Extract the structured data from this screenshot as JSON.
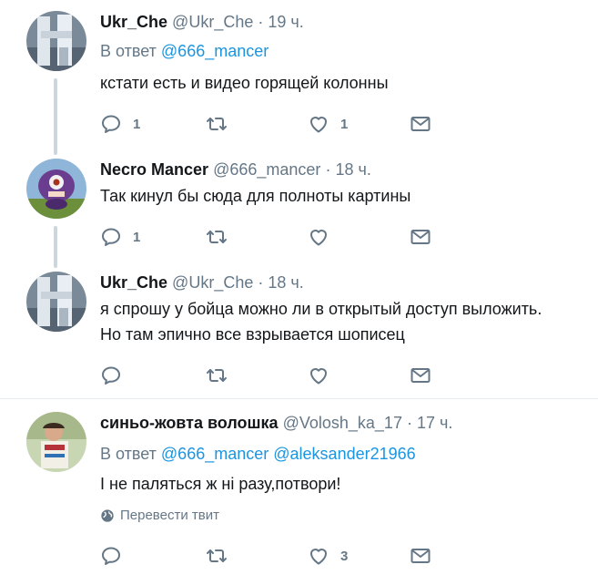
{
  "tweets": [
    {
      "name": "Ukr_Che",
      "handle": "@Ukr_Che",
      "dot": "·",
      "time": "19 ч.",
      "reply_prefix": "В ответ",
      "reply_mentions": [
        "@666_mancer"
      ],
      "text": "кстати есть и видео горящей колонны",
      "replies": "1",
      "retweets": "",
      "likes": "1"
    },
    {
      "name": "Necro Mancer",
      "handle": "@666_mancer",
      "dot": "·",
      "time": "18 ч.",
      "text": "Так кинул бы сюда для полноты картины",
      "replies": "1",
      "retweets": "",
      "likes": ""
    },
    {
      "name": "Ukr_Che",
      "handle": "@Ukr_Che",
      "dot": "·",
      "time": "18 ч.",
      "text_line1": "я спрошу у бойца можно ли в открытый доступ выложить.",
      "text_line2": "Но там эпично все взрывается шописец",
      "replies": "",
      "retweets": "",
      "likes": ""
    },
    {
      "name": "синьо-жовта волошка",
      "handle": "@Volosh_ka_17",
      "dot": "·",
      "time": "17 ч.",
      "reply_prefix": "В ответ",
      "reply_mentions": [
        "@666_mancer",
        "@aleksander21966"
      ],
      "text": "І не паляться ж ні разу,потвори!",
      "translate": "Перевести твит",
      "replies": "",
      "retweets": "",
      "likes": "3"
    }
  ],
  "icons": {
    "reply": "reply-icon",
    "retweet": "retweet-icon",
    "like": "heart-icon",
    "dm": "envelope-icon",
    "globe": "globe-icon"
  },
  "colors": {
    "icon": "#657786",
    "mention": "#1b95e0",
    "thread_line": "#ccd6dd"
  }
}
